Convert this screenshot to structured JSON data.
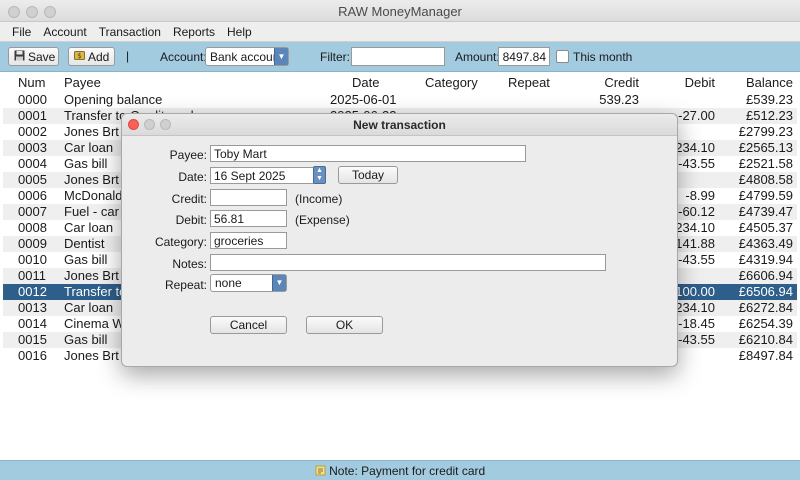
{
  "window": {
    "title": "RAW MoneyManager"
  },
  "menu": [
    "File",
    "Account",
    "Transaction",
    "Reports",
    "Help"
  ],
  "toolbar": {
    "save_label": "Save",
    "add_label": "Add",
    "separator": "|",
    "account_label": "Account:",
    "account_value": "Bank account",
    "filter_label": "Filter:",
    "filter_value": "",
    "amount_label": "Amount:",
    "amount_value": "8497.84",
    "this_month_label": "This month",
    "this_month_checked": false
  },
  "table": {
    "headers": {
      "num": "Num",
      "payee": "Payee",
      "date": "Date",
      "category": "Category",
      "repeat": "Repeat",
      "credit": "Credit",
      "debit": "Debit",
      "balance": "Balance"
    },
    "rows": [
      {
        "num": "0000",
        "payee": "Opening balance",
        "date": "2025-06-01",
        "credit": "539.23",
        "debit": "",
        "balance": "£539.23"
      },
      {
        "num": "0001",
        "payee": "Transfer to Credit card",
        "date": "2025-06-22",
        "credit": "",
        "debit": "-27.00",
        "balance": "£512.23"
      },
      {
        "num": "0002",
        "payee": "Jones Brt",
        "date": "",
        "credit": "",
        "debit": "",
        "balance": "£2799.23"
      },
      {
        "num": "0003",
        "payee": "Car loan",
        "date": "",
        "credit": "",
        "debit": "-234.10",
        "balance": "£2565.13"
      },
      {
        "num": "0004",
        "payee": "Gas bill",
        "date": "",
        "credit": "",
        "debit": "-43.55",
        "balance": "£2521.58"
      },
      {
        "num": "0005",
        "payee": "Jones Brt",
        "date": "",
        "credit": "",
        "debit": "",
        "balance": "£4808.58"
      },
      {
        "num": "0006",
        "payee": "McDonalds",
        "date": "",
        "credit": "",
        "debit": "-8.99",
        "balance": "£4799.59"
      },
      {
        "num": "0007",
        "payee": "Fuel - car",
        "date": "",
        "credit": "",
        "debit": "-60.12",
        "balance": "£4739.47"
      },
      {
        "num": "0008",
        "payee": "Car loan",
        "date": "",
        "credit": "",
        "debit": "-234.10",
        "balance": "£4505.37"
      },
      {
        "num": "0009",
        "payee": "Dentist",
        "date": "",
        "credit": "",
        "debit": "-141.88",
        "balance": "£4363.49"
      },
      {
        "num": "0010",
        "payee": "Gas bill",
        "date": "",
        "credit": "",
        "debit": "-43.55",
        "balance": "£4319.94"
      },
      {
        "num": "0011",
        "payee": "Jones Brt",
        "date": "",
        "credit": "",
        "debit": "",
        "balance": "£6606.94"
      },
      {
        "num": "0012",
        "payee": "Transfer to",
        "date": "",
        "credit": "",
        "debit": "-100.00",
        "balance": "£6506.94"
      },
      {
        "num": "0013",
        "payee": "Car loan",
        "date": "",
        "credit": "",
        "debit": "-234.10",
        "balance": "£6272.84"
      },
      {
        "num": "0014",
        "payee": "Cinema Wo",
        "date": "",
        "credit": "",
        "debit": "-18.45",
        "balance": "£6254.39"
      },
      {
        "num": "0015",
        "payee": "Gas bill",
        "date": "",
        "credit": "",
        "debit": "-43.55",
        "balance": "£6210.84"
      },
      {
        "num": "0016",
        "payee": "Jones Brt",
        "date": "",
        "credit": "",
        "debit": "",
        "balance": "£8497.84"
      }
    ],
    "selected_row": 12
  },
  "status": {
    "text": "Note: Payment for credit card"
  },
  "dialog": {
    "title": "New transaction",
    "payee_label": "Payee:",
    "payee_value": "Toby Mart",
    "date_label": "Date:",
    "date_value": "16 Sept 2025",
    "today_label": "Today",
    "credit_label": "Credit:",
    "credit_value": "",
    "credit_hint": "(Income)",
    "debit_label": "Debit:",
    "debit_value": "56.81",
    "debit_hint": "(Expense)",
    "category_label": "Category:",
    "category_value": "groceries",
    "notes_label": "Notes:",
    "notes_value": "",
    "repeat_label": "Repeat:",
    "repeat_value": "none",
    "cancel_label": "Cancel",
    "ok_label": "OK"
  },
  "colors": {
    "toolbar_bg": "#a3cbe0",
    "selected_row": "#2e5e8a",
    "select_accent": "#5a86b8"
  },
  "icons": {
    "save": "floppy-disk-icon",
    "add": "add-money-icon",
    "status": "note-icon"
  }
}
